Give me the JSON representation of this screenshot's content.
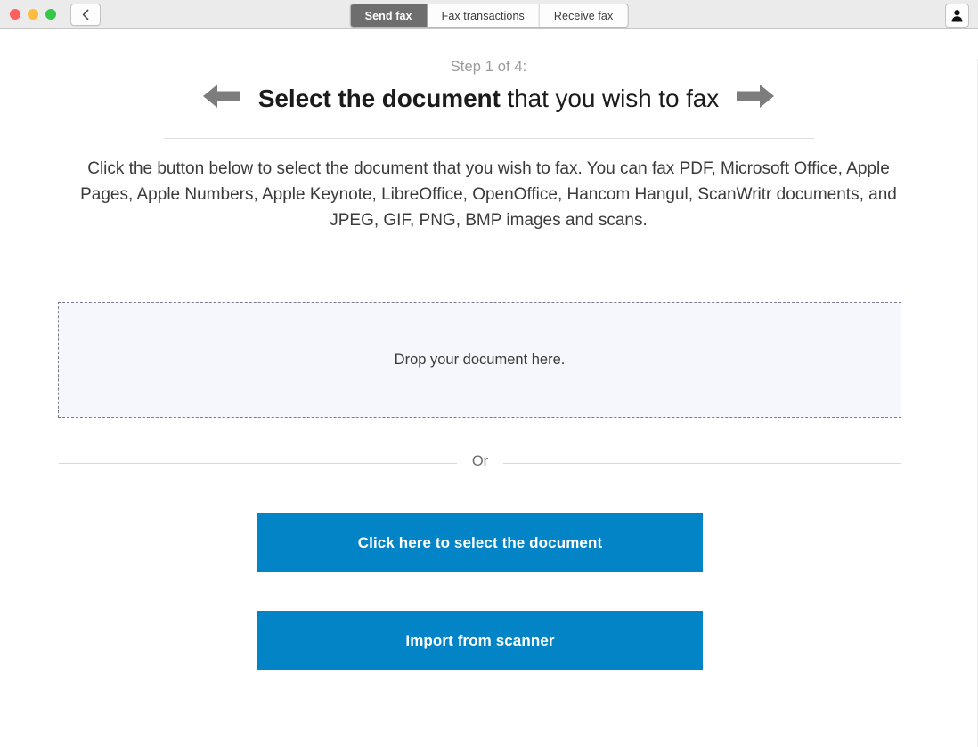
{
  "window": {
    "traffic_lights": [
      "close",
      "minimize",
      "maximize"
    ],
    "back_icon": "chevron-left-icon",
    "avatar_icon": "user-avatar-icon"
  },
  "tabs": [
    {
      "label": "Send fax",
      "active": true
    },
    {
      "label": "Fax transactions",
      "active": false
    },
    {
      "label": "Receive fax",
      "active": false
    }
  ],
  "wizard": {
    "step_label": "Step 1 of 4:",
    "title_strong": "Select the document",
    "title_rest": " that you wish to fax",
    "prev_icon": "arrow-left-icon",
    "next_icon": "arrow-right-icon"
  },
  "description": "Click the button below to select the document that you wish to fax. You can fax PDF, Microsoft Office, Apple Pages, Apple Numbers, Apple Keynote, LibreOffice, OpenOffice, Hancom Hangul, ScanWritr documents, and JPEG, GIF, PNG, BMP images and scans.",
  "dropzone": {
    "text": "Drop your document here."
  },
  "separator": {
    "text": "Or"
  },
  "buttons": {
    "select_document": "Click here to select the document",
    "import_scanner": "Import from scanner"
  },
  "colors": {
    "accent_blue": "#0384c6",
    "tab_active_bg": "#6e6e6e",
    "titlebar_bg": "#ebebeb",
    "dropzone_bg": "#f6f7fd",
    "arrow_gray": "#7d7d7d"
  }
}
